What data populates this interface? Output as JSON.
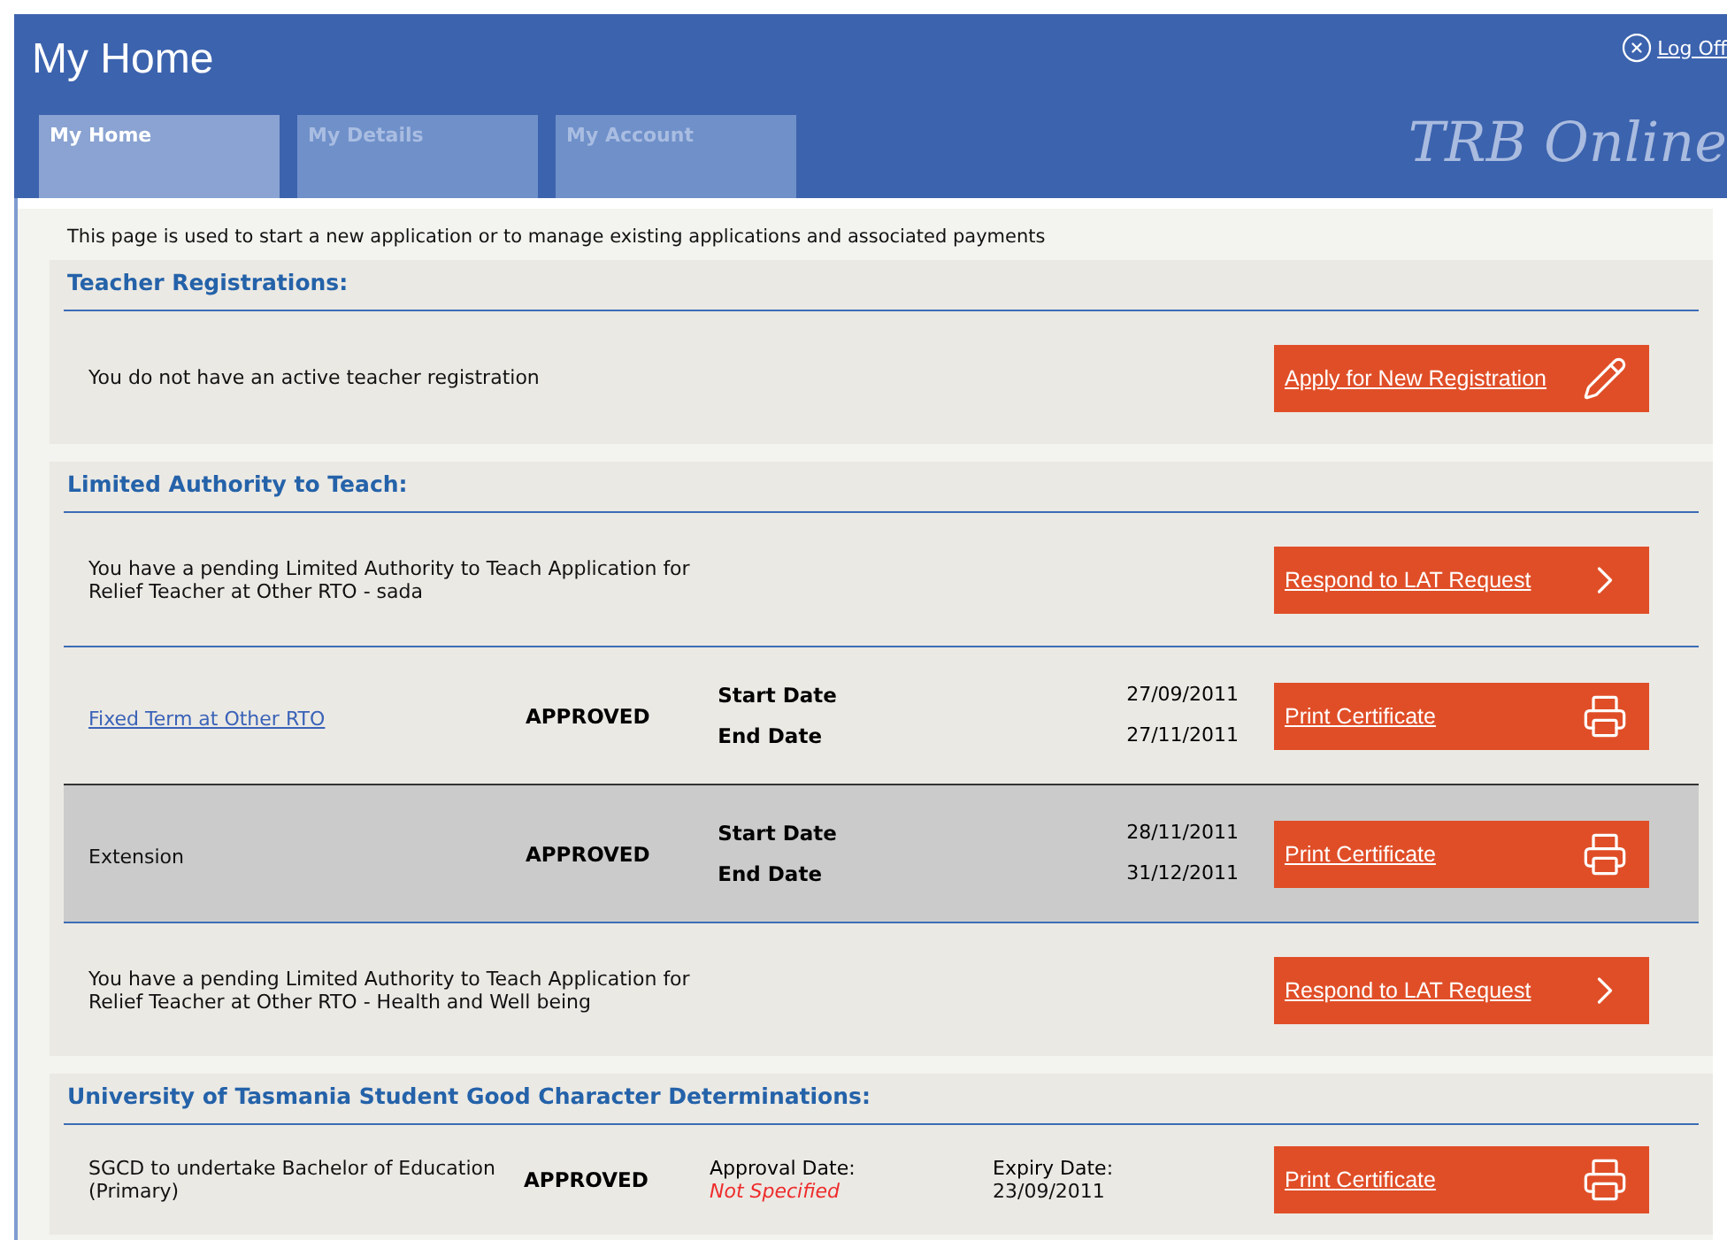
{
  "header": {
    "title": "My Home",
    "logoff": "Log Off",
    "brand": "TRB Online"
  },
  "tabs": [
    {
      "label": "My Home",
      "selected": true
    },
    {
      "label": "My Details",
      "selected": false
    },
    {
      "label": "My Account",
      "selected": false
    }
  ],
  "intro": "This page is used to start a new application or to manage existing applications and associated payments",
  "sections": [
    {
      "title": "Teacher Registrations:",
      "items": [
        {
          "kind": "message",
          "text": "You do not have an active teacher registration",
          "button": {
            "label": "Apply for New Registration"
          }
        }
      ]
    },
    {
      "title": "Limited Authority to Teach:",
      "items": [
        {
          "kind": "message",
          "text": "You have a pending Limited Authority to Teach Application for\nRelief Teacher at Other RTO - sada",
          "button": {
            "label": "Respond to LAT Request"
          }
        },
        {
          "kind": "period",
          "name": "Fixed Term at Other RTO",
          "linked": true,
          "highlighted": false,
          "status": "APPROVED",
          "start_label": "Start Date",
          "start": "27/09/2011",
          "end_label": "End Date",
          "end": "27/11/2011",
          "button": {
            "label": "Print Certificate"
          }
        },
        {
          "kind": "period",
          "name": "Extension",
          "linked": false,
          "highlighted": true,
          "status": "APPROVED",
          "start_label": "Start Date",
          "start": "28/11/2011",
          "end_label": "End Date",
          "end": "31/12/2011",
          "button": {
            "label": "Print Certificate"
          }
        },
        {
          "kind": "message",
          "text": "You have a pending Limited Authority to Teach Application for\nRelief Teacher at Other RTO - Health and Well being",
          "button": {
            "label": "Respond to LAT Request"
          }
        }
      ]
    },
    {
      "title": "University of Tasmania Student Good Character Determinations:",
      "items": [
        {
          "kind": "determination",
          "name": "SGCD to undertake Bachelor of Education\n(Primary)",
          "status": "APPROVED",
          "approval_label": "Approval Date:",
          "approval": "Not Specified",
          "approval_missing": true,
          "expiry_label": "Expiry Date:",
          "expiry": "23/09/2011",
          "button": {
            "label": "Print Certificate"
          }
        }
      ]
    }
  ]
}
